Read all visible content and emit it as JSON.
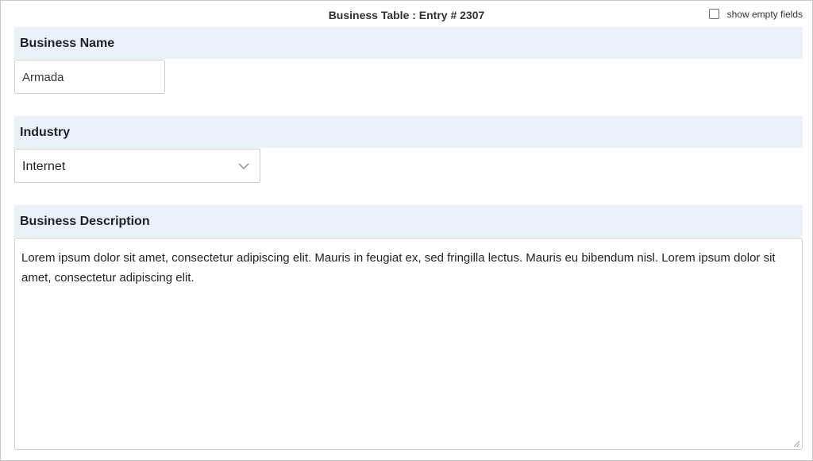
{
  "header": {
    "title": "Business Table : Entry # 2307",
    "show_empty_label": "show empty fields",
    "show_empty_checked": false
  },
  "fields": {
    "business_name": {
      "label": "Business Name",
      "value": "Armada"
    },
    "industry": {
      "label": "Industry",
      "value": "Internet"
    },
    "business_description": {
      "label": "Business Description",
      "value": "Lorem ipsum dolor sit amet, consectetur adipiscing elit. Mauris in feugiat ex, sed fringilla lectus. Mauris eu bibendum nisl. Lorem ipsum dolor sit amet, consectetur adipiscing elit."
    }
  },
  "icons": {
    "dropdown": "chevron-down-icon",
    "resize": "resize-handle-icon",
    "checkbox": "checkbox-icon"
  },
  "colors": {
    "header_bg": "#eaf1fb",
    "border": "#c9cdd2",
    "text": "#1d2327"
  }
}
